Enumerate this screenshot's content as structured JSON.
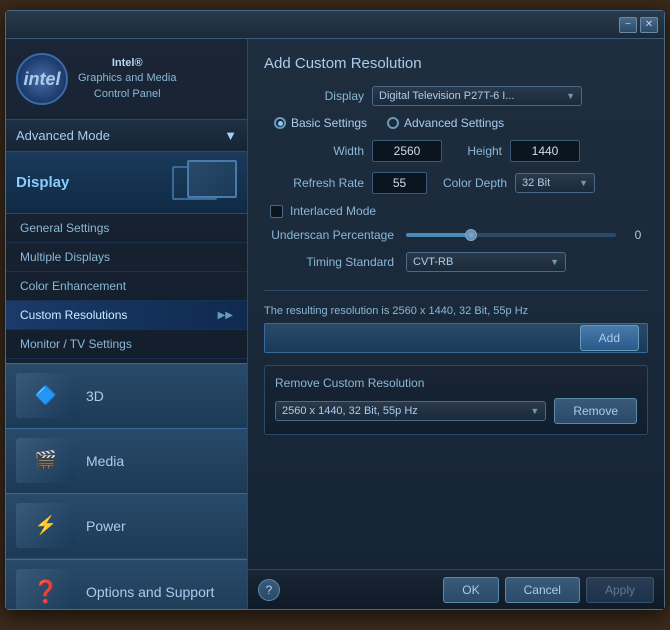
{
  "window": {
    "title": "Intel Graphics and Media Control Panel",
    "minimize_label": "−",
    "close_label": "✕"
  },
  "sidebar": {
    "logo_text": "intel",
    "company_line1": "Intel®",
    "company_line2": "Graphics and Media",
    "company_line3": "Control Panel",
    "mode_label": "Advanced Mode",
    "display_label": "Display",
    "nav_items": [
      {
        "label": "General Settings",
        "active": false
      },
      {
        "label": "Multiple Displays",
        "active": false
      },
      {
        "label": "Color Enhancement",
        "active": false
      },
      {
        "label": "Custom Resolutions",
        "active": true
      },
      {
        "label": "Monitor / TV Settings",
        "active": false
      }
    ],
    "sections": [
      {
        "label": "3D",
        "icon": "🔷"
      },
      {
        "label": "Media",
        "icon": "🎬"
      },
      {
        "label": "Power",
        "icon": "⚡"
      }
    ],
    "options_label": "Options and Support"
  },
  "content": {
    "title": "Add Custom Resolution",
    "display_label": "Display",
    "display_value": "Digital Television P27T-6 I...",
    "radio_basic": "Basic Settings",
    "radio_advanced": "Advanced Settings",
    "width_label": "Width",
    "width_value": "2560",
    "height_label": "Height",
    "height_value": "1440",
    "refresh_label": "Refresh Rate",
    "refresh_value": "55",
    "color_depth_label": "Color Depth",
    "color_depth_value": "32 Bit",
    "interlaced_label": "Interlaced Mode",
    "underscan_label": "Underscan Percentage",
    "underscan_value": "0",
    "timing_label": "Timing Standard",
    "timing_value": "CVT-RB",
    "result_text": "The resulting resolution is 2560 x 1440, 32 Bit, 55p Hz",
    "add_button": "Add",
    "remove_section_title": "Remove Custom Resolution",
    "remove_dropdown_value": "2560 x 1440, 32 Bit, 55p Hz",
    "remove_button": "Remove"
  },
  "bottom_bar": {
    "help_label": "?",
    "ok_label": "OK",
    "cancel_label": "Cancel",
    "apply_label": "Apply"
  }
}
